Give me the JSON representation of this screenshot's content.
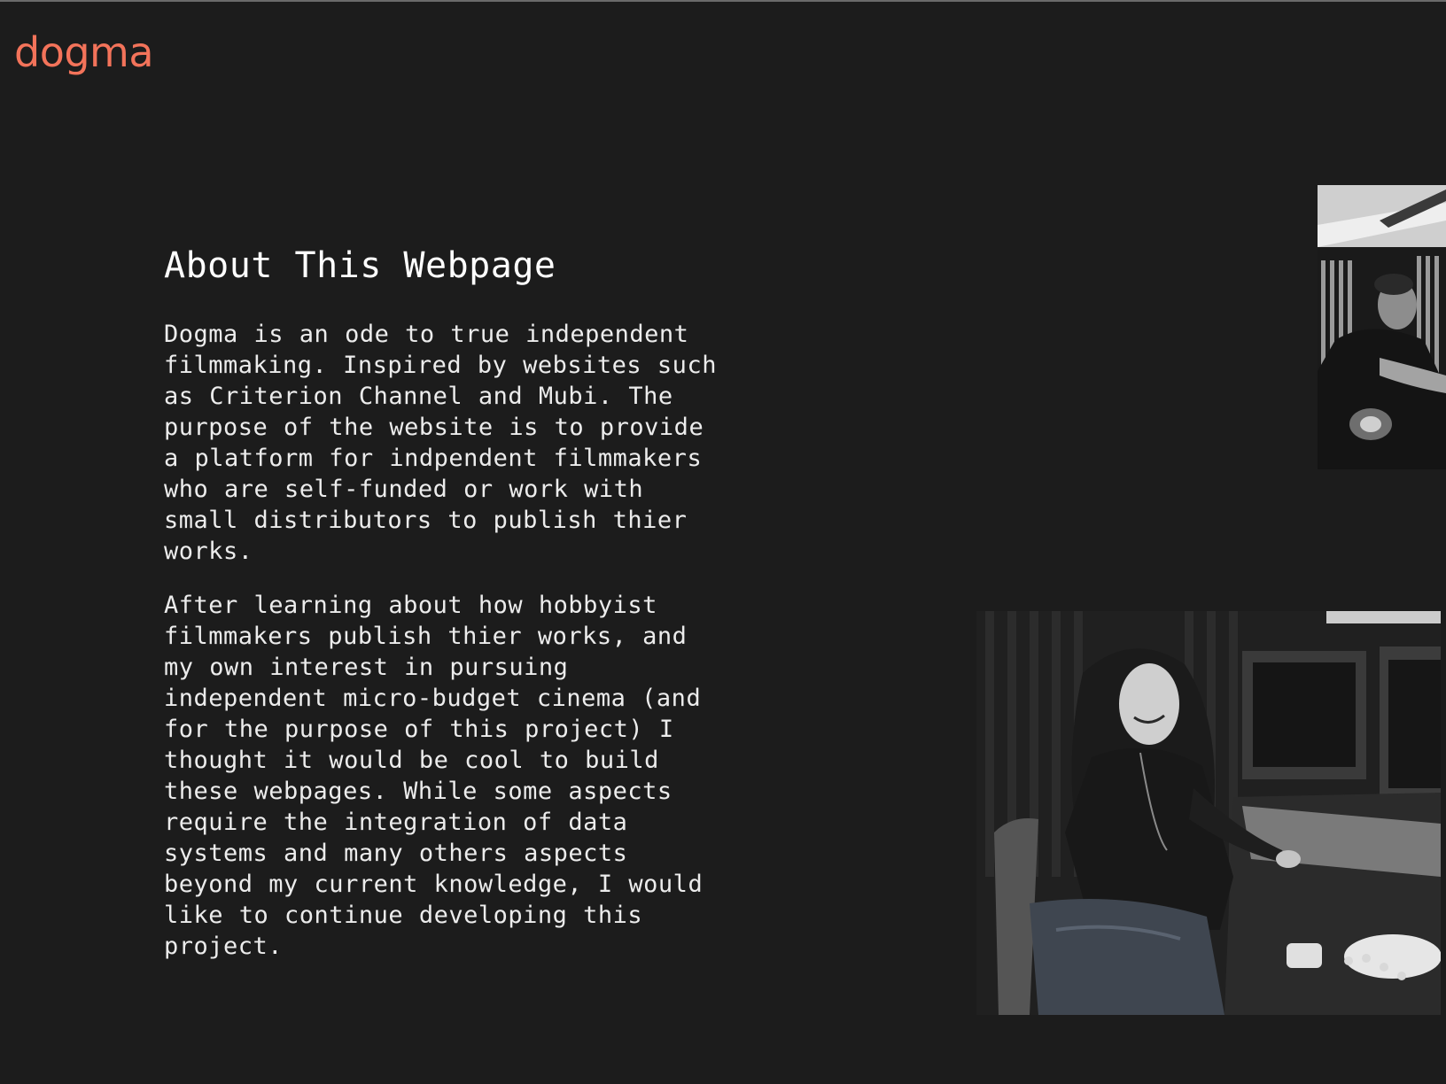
{
  "header": {
    "logo_text": "dogma"
  },
  "main": {
    "title": "About This Webpage",
    "paragraphs": [
      "Dogma is an ode to true independent filmmaking. Inspired by websites such as Criterion Channel and Mubi. The purpose of the website is to provide a platform for indpendent filmmakers who are self-funded or work with small distributors to publish thier works.",
      "After learning about how hobbyist filmmakers publish thier works, and my own interest in pursuing independent micro-budget cinema (and for the purpose of this project) I thought it would be cool to build these webpages. While some aspects require the integration of data systems and many others aspects beyond my current knowledge, I would like to continue developing this project."
    ]
  },
  "images": [
    {
      "name": "photo-man-editing",
      "style": "black-and-white"
    },
    {
      "name": "photo-woman-editing-suite",
      "style": "black-and-white"
    }
  ],
  "colors": {
    "background": "#1c1c1c",
    "logo": "#f3735a",
    "text": "#ececec"
  }
}
